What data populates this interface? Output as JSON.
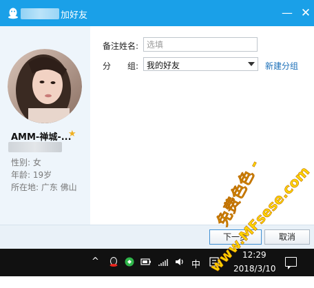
{
  "window": {
    "title": "加好友",
    "minimize_glyph": "—",
    "close_glyph": "✕"
  },
  "profile": {
    "nickname": "AMM-禅城-...",
    "gender": "性别: 女",
    "age": "年龄: 19岁",
    "location": "所在地: 广东  佛山"
  },
  "form": {
    "remark_label": "备注姓名:",
    "remark_placeholder": "选填",
    "remark_value": "",
    "group_label": "分　　组:",
    "group_value": "我的好友",
    "new_group_link": "新建分组"
  },
  "buttons": {
    "next": "下一步",
    "cancel": "取消"
  },
  "taskbar": {
    "ime_label": "中",
    "time": "12:29",
    "date": "2018/3/10"
  },
  "watermark": {
    "line1": "免费色色 -",
    "line2": "www.MFsese.com"
  },
  "colors": {
    "title_bar": "#1aa0e8",
    "link": "#1b6fb8",
    "watermark": "#ffd400",
    "star": "#f0b020"
  }
}
